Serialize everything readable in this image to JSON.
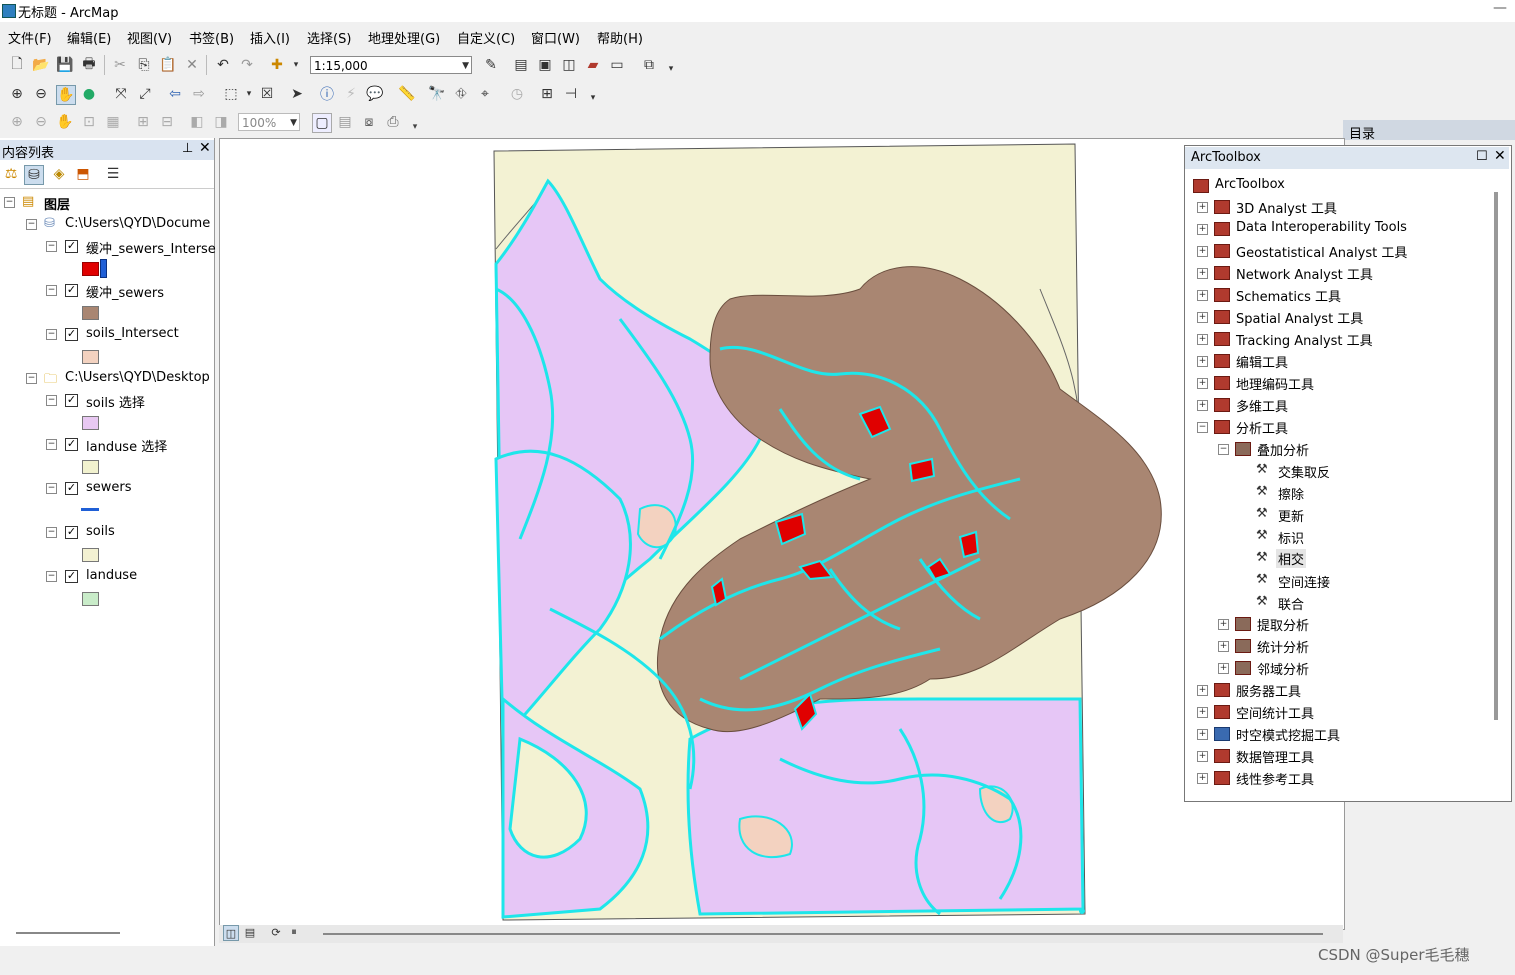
{
  "window": {
    "title": "无标题 - ArcMap"
  },
  "menu": [
    "文件(F)",
    "编辑(E)",
    "视图(V)",
    "书签(B)",
    "插入(I)",
    "选择(S)",
    "地理处理(G)",
    "自定义(C)",
    "窗口(W)",
    "帮助(H)"
  ],
  "toolbar": {
    "scale": "1:15,000",
    "zoom": "100%"
  },
  "toc": {
    "title": "内容列表",
    "root": "图层",
    "groups": [
      {
        "path": "C:\\Users\\QYD\\Docume",
        "layers": [
          {
            "name": "缓冲_sewers_Interse",
            "swatch": "#e00000",
            "swatch2": "#1f5fd6"
          },
          {
            "name": "缓冲_sewers",
            "swatch": "#a98672"
          },
          {
            "name": "soils_Intersect",
            "swatch": "#f3d2c0"
          }
        ]
      },
      {
        "path": "C:\\Users\\QYD\\Desktop",
        "layers": [
          {
            "name": "soils 选择",
            "swatch": "#e8c8f2"
          },
          {
            "name": "landuse 选择",
            "swatch": "#f2f2cf"
          },
          {
            "name": "sewers",
            "swatch": "line"
          },
          {
            "name": "soils",
            "swatch": "#f3f1d2"
          },
          {
            "name": "landuse",
            "swatch": "#c9ecc9"
          }
        ]
      }
    ]
  },
  "catalog": {
    "title": "目录"
  },
  "toolbox": {
    "title": "ArcToolbox",
    "root": "ArcToolbox",
    "items": [
      "3D Analyst 工具",
      "Data Interoperability Tools",
      "Geostatistical Analyst 工具",
      "Network Analyst 工具",
      "Schematics 工具",
      "Spatial Analyst 工具",
      "Tracking Analyst 工具",
      "编辑工具",
      "地理编码工具",
      "多维工具",
      "分析工具"
    ],
    "overlay_group": "叠加分析",
    "overlay_tools": [
      "交集取反",
      "擦除",
      "更新",
      "标识",
      "相交",
      "空间连接",
      "联合"
    ],
    "sub_groups": [
      "提取分析",
      "统计分析",
      "邻域分析"
    ],
    "more_items": [
      "服务器工具",
      "空间统计工具",
      "时空模式挖掘工具",
      "数据管理工具",
      "线性参考工具"
    ]
  },
  "watermark": "CSDN @Super毛毛穗",
  "colors": {
    "background": "#f3f2d3",
    "soils_select": "#e6c6f6",
    "buffer": "#a98672",
    "intersect": "#e00000",
    "outline": "#1ee6ea"
  }
}
